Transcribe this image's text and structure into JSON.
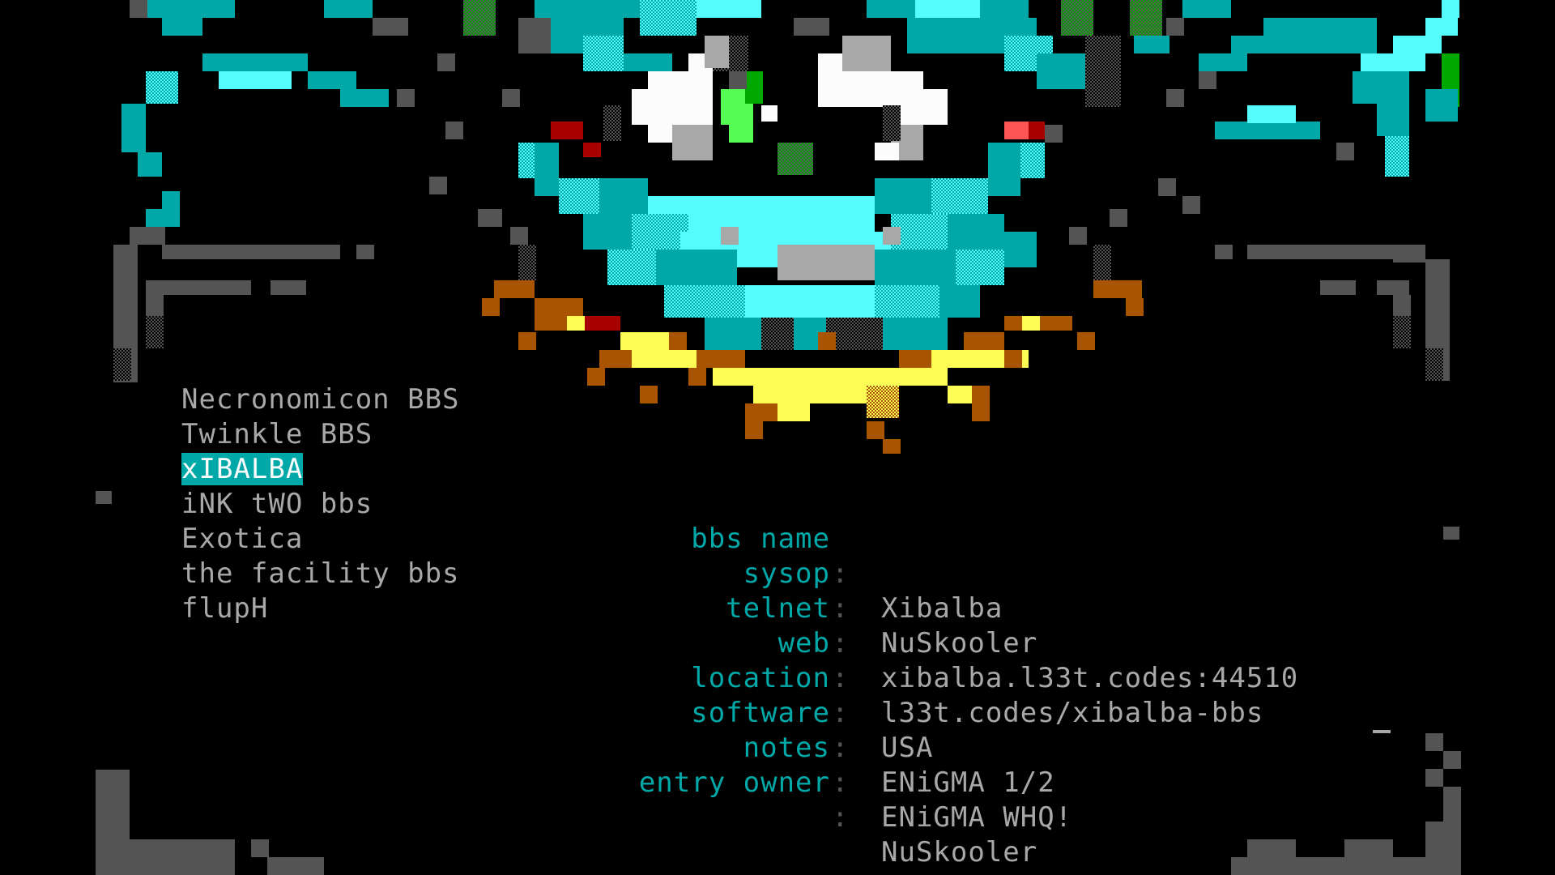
{
  "bbs_list": [
    {
      "name": "Necronomicon BBS",
      "selected": false
    },
    {
      "name": "Twinkle BBS",
      "selected": false
    },
    {
      "name": "xIBALBA",
      "selected": true
    },
    {
      "name": "iNK tWO bbs",
      "selected": false
    },
    {
      "name": "Exotica",
      "selected": false
    },
    {
      "name": "the facility bbs",
      "selected": false
    },
    {
      "name": "flupH",
      "selected": false
    }
  ],
  "details": {
    "bbs_name": {
      "label": "bbs name",
      "value": "Xibalba"
    },
    "sysop": {
      "label": "sysop",
      "value": "NuSkooler"
    },
    "telnet": {
      "label": "telnet",
      "value": "xibalba.l33t.codes:44510"
    },
    "web": {
      "label": "web",
      "value": "l33t.codes/xibalba-bbs"
    },
    "location": {
      "label": "location",
      "value": "USA"
    },
    "software": {
      "label": "software",
      "value": "ENiGMA 1/2"
    },
    "notes": {
      "label": "notes",
      "value": "ENiGMA WHQ!"
    },
    "entry_owner": {
      "label": "entry owner",
      "value": "NuSkooler"
    }
  },
  "colon": ":",
  "colors": {
    "background": "#000000",
    "label": "#00a8a8",
    "text": "#a8a8a8",
    "highlight_bg": "#00a8a8",
    "highlight_fg": "#fcfcfc"
  }
}
